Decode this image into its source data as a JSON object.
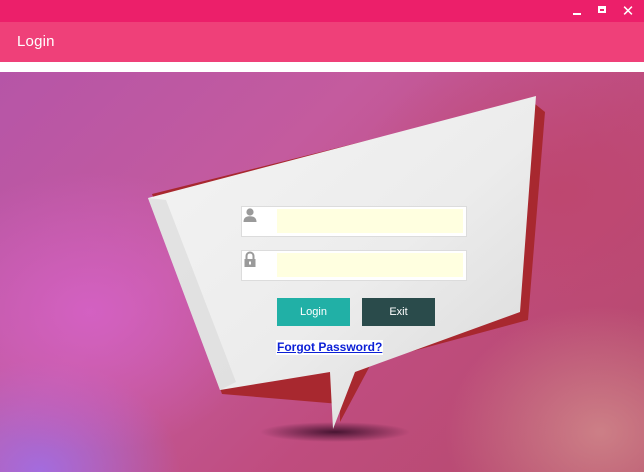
{
  "window": {
    "minimize_glyph": "",
    "maximize_glyph": "",
    "close_glyph": "✕"
  },
  "header": {
    "title": "Login"
  },
  "form": {
    "username": {
      "value": "",
      "placeholder": "",
      "icon": "user-icon"
    },
    "password": {
      "value": "",
      "placeholder": "",
      "icon": "lock-icon"
    },
    "login_label": "Login",
    "exit_label": "Exit",
    "forgot_label": "Forgot Password?"
  },
  "colors": {
    "titlebar": "#ec1f6a",
    "header": "#ef4079",
    "login_button": "#21b0a6",
    "exit_button": "#2a4b4b",
    "input_fill": "#ffffe0",
    "link": "#0b1fd6"
  }
}
